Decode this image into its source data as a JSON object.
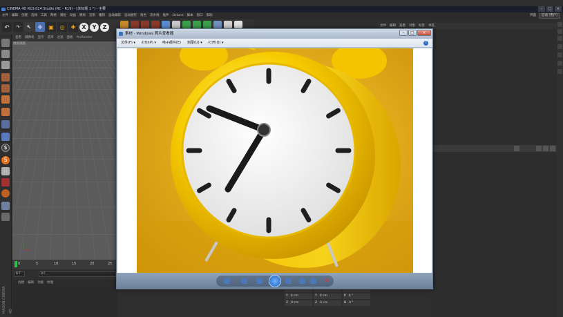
{
  "c4d": {
    "title": "CINEMA 4D R19.024 Studio (RC - R19) - [未标题 1 *] - 主要",
    "menus": [
      "文件",
      "编辑",
      "创建",
      "选择",
      "工具",
      "网格",
      "捕捉",
      "动画",
      "模拟",
      "渲染",
      "雕刻",
      "运动跟踪",
      "运动图形",
      "角色",
      "流水线",
      "插件",
      "Octane",
      "脚本",
      "窗口",
      "帮助"
    ],
    "layout_label": "界面",
    "layout_value": "启动 (用户)",
    "viewport_menus": [
      "查看",
      "摄像机",
      "显示",
      "选项",
      "过滤",
      "面板",
      "ProRender"
    ],
    "viewport_name": "透视视图",
    "timeline_marks": [
      "0",
      "5",
      "10",
      "15",
      "20",
      "25"
    ],
    "frame_start": "0 F",
    "frame_field": "0 F",
    "bottom_tabs": [
      "创建",
      "编辑",
      "功能",
      "纹理"
    ],
    "object_panel_menus": [
      "文件",
      "编辑",
      "查看",
      "对象",
      "标签",
      "书签"
    ],
    "coords": [
      {
        "a": "X",
        "v": "0 cm",
        "b": "X",
        "w": "0 cm",
        "c": "H",
        "x": "0 °"
      },
      {
        "a": "Y",
        "v": "0 cm",
        "b": "Y",
        "w": "0 cm",
        "c": "P",
        "x": "0 °"
      },
      {
        "a": "Z",
        "v": "0 cm",
        "b": "Z",
        "w": "0 cm",
        "c": "B",
        "x": "0 °"
      }
    ],
    "brand": "MAXON CINEMA 4D"
  },
  "viewer": {
    "title": "素材 - Windows 照片查看器",
    "menus": [
      "文件(F) ▾",
      "打印(P) ▾",
      "电子邮件(E)",
      "刻录(U) ▾",
      "打开(O) ▾"
    ],
    "help": "?",
    "colors": {
      "clock_yellow": "#f2c200",
      "wall": "#e0a917",
      "dial": "#f1f1f1"
    }
  }
}
